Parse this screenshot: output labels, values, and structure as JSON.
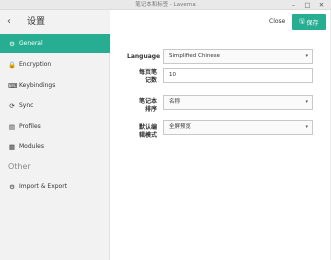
{
  "window": {
    "title": "笔记本和标签 - Laverna",
    "minimize_glyph": "–",
    "maximize_glyph": "□",
    "close_glyph": "✕"
  },
  "header": {
    "back_glyph": "‹",
    "title": "设置",
    "close_label": "Close",
    "save_label": "保存",
    "save_icon_glyph": "🖫"
  },
  "sidebar": {
    "items": [
      {
        "label": "General",
        "icon": "gear-icon",
        "glyph": "⚙",
        "active": true
      },
      {
        "label": "Encryption",
        "icon": "lock-icon",
        "glyph": "🔒",
        "active": false
      },
      {
        "label": "Keybindings",
        "icon": "keyboard-icon",
        "glyph": "⌨",
        "active": false
      },
      {
        "label": "Sync",
        "icon": "sync-icon",
        "glyph": "⟳",
        "active": false
      },
      {
        "label": "Profiles",
        "icon": "book-icon",
        "glyph": "▤",
        "active": false
      },
      {
        "label": "Modules",
        "icon": "stack-icon",
        "glyph": "▦",
        "active": false
      }
    ],
    "other_section": "Other",
    "other_items": [
      {
        "label": "Import & Export",
        "icon": "cog-icon",
        "glyph": "⚙"
      }
    ]
  },
  "form": {
    "language": {
      "label": "Language",
      "value": "Simplified Chinese"
    },
    "notes_per_page": {
      "label_line1": "每页笔",
      "label_line2": "记数",
      "value": "10"
    },
    "notebook_sort": {
      "label_line1": "笔记本",
      "label_line2": "排序",
      "value": "名称"
    },
    "default_edit_mode": {
      "label_line1": "默认编",
      "label_line2": "辑模式",
      "value": "全屏预览"
    },
    "caret_glyph": "▾"
  },
  "colors": {
    "accent": "#27ae92",
    "sidebar_bg": "#f2f2f2"
  }
}
